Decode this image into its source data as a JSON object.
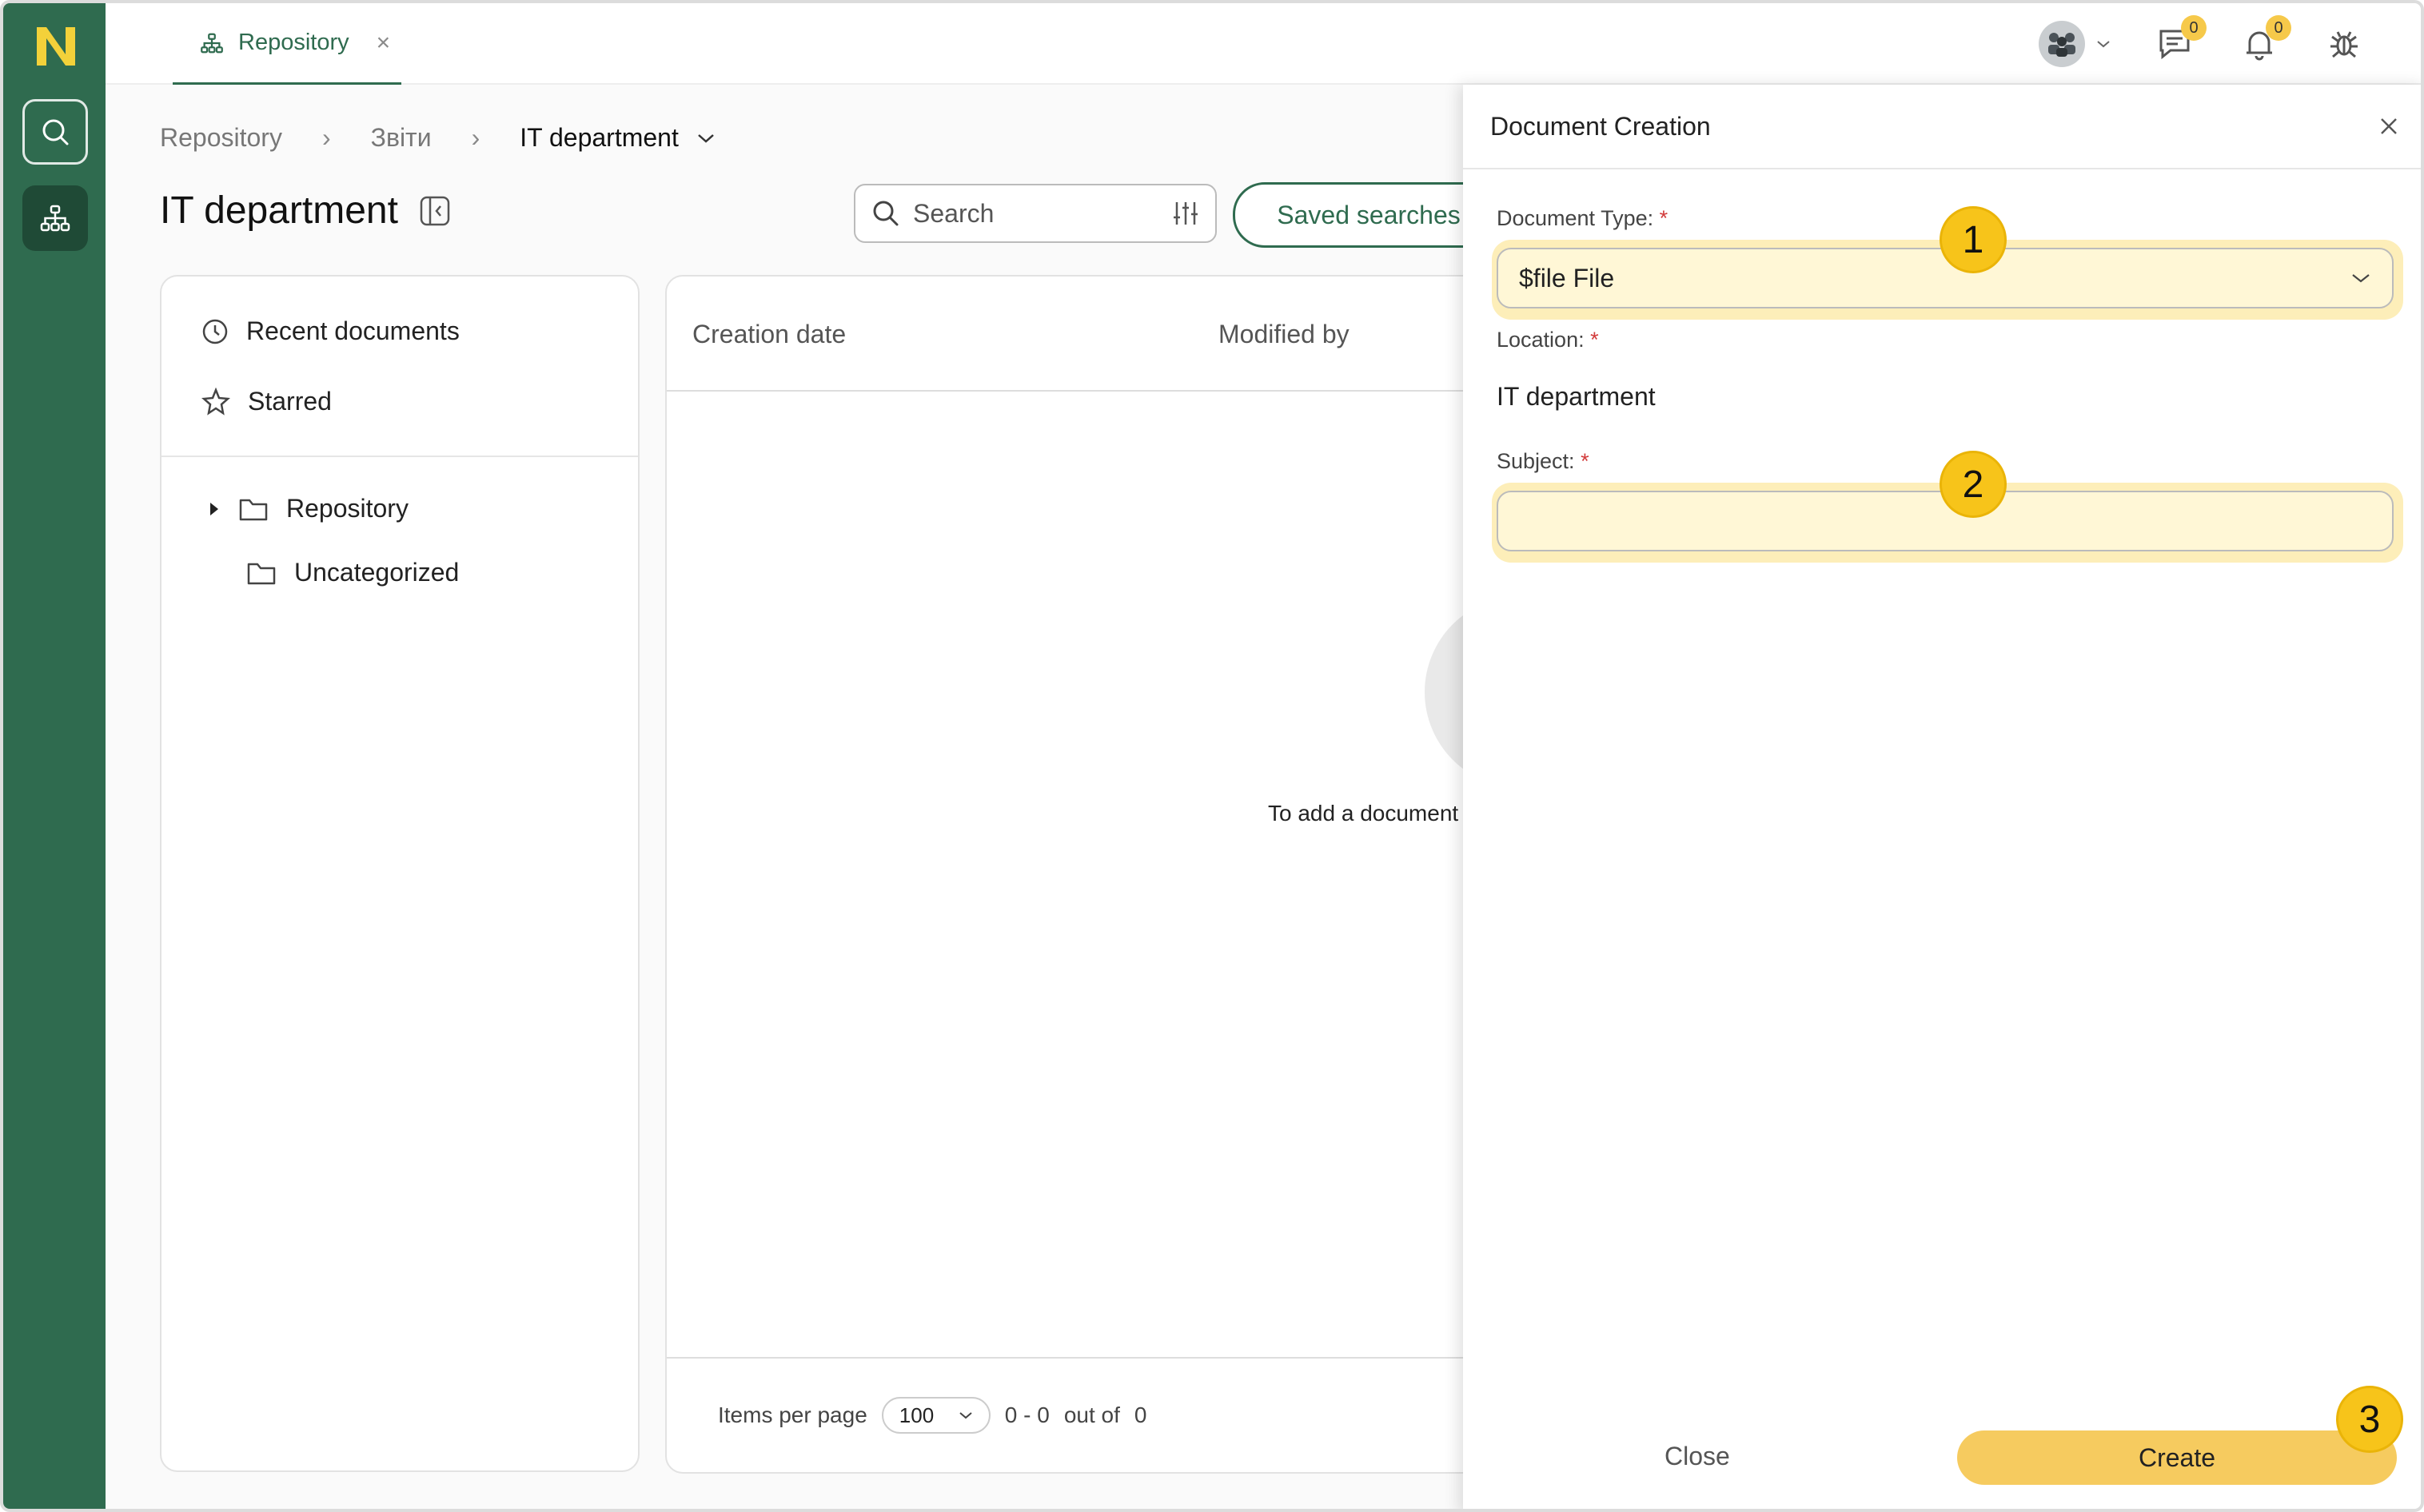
{
  "tab": {
    "label": "Repository",
    "close": "×"
  },
  "badges": {
    "messages": "0",
    "notifications": "0"
  },
  "breadcrumb": {
    "items": [
      "Repository",
      "Звіти"
    ],
    "current": "IT department"
  },
  "page_title": "IT department",
  "search": {
    "placeholder": "Search"
  },
  "saved_searches_label": "Saved searches",
  "side_panel": {
    "recent": "Recent documents",
    "starred": "Starred",
    "tree": [
      "Repository",
      "Uncategorized"
    ]
  },
  "table": {
    "columns": [
      "Creation date",
      "Modified by"
    ],
    "empty_text": "To add a document c"
  },
  "pager": {
    "label": "Items per page",
    "per_page": "100",
    "range": "0 - 0",
    "out_of_label": "out of",
    "total": "0"
  },
  "dialog": {
    "title": "Document Creation",
    "doc_type_label": "Document Type:",
    "doc_type_value": "$file File",
    "location_label": "Location:",
    "location_value": "IT department",
    "subject_label": "Subject:",
    "required_mark": "*",
    "close_label": "Close",
    "create_label": "Create",
    "steps": [
      "1",
      "2",
      "3"
    ]
  },
  "colors": {
    "brand": "#2f6b4f",
    "accent": "#f6cb5f",
    "logo": "#f3d13a",
    "highlight": "#fdeeb9"
  },
  "icons": [
    "logo-icon",
    "search-icon",
    "hierarchy-icon",
    "users-icon",
    "chat-icon",
    "bell-icon",
    "bug-icon",
    "clock-icon",
    "star-icon",
    "folder-icon",
    "filter-icon",
    "chevron-down-icon",
    "close-icon",
    "panel-collapse-icon"
  ]
}
